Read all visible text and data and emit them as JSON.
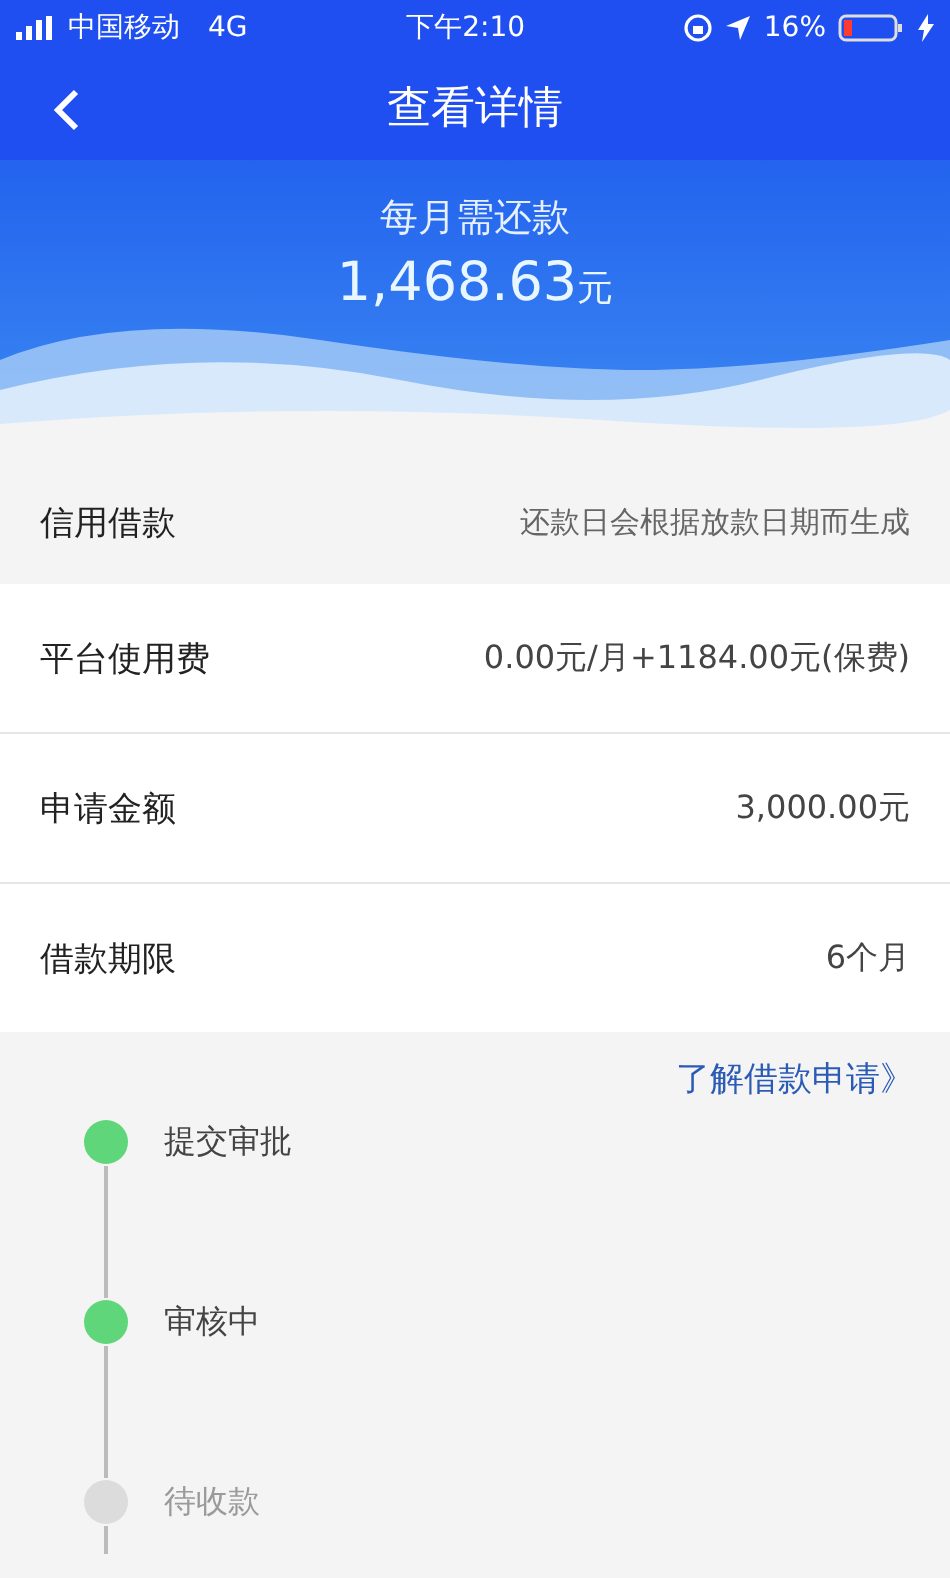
{
  "status_bar": {
    "carrier": "中国移动",
    "network": "4G",
    "time": "下午2:10",
    "battery": "16%"
  },
  "nav": {
    "title": "查看详情"
  },
  "header": {
    "label": "每月需还款",
    "amount": "1,468.63",
    "unit": "元"
  },
  "rows": [
    {
      "label": "信用借款",
      "value": "还款日会根据放款日期而生成",
      "kind": "note"
    },
    {
      "label": "平台使用费",
      "value": "0.00元/月+1184.00元(保费)",
      "kind": "item"
    },
    {
      "label": "申请金额",
      "value": "3,000.00元",
      "kind": "item"
    },
    {
      "label": "借款期限",
      "value": "6个月",
      "kind": "item"
    }
  ],
  "link": {
    "text": "了解借款申请",
    "arrow": "》"
  },
  "steps": [
    {
      "label": "提交审批",
      "completed": true
    },
    {
      "label": "审核中",
      "completed": true
    },
    {
      "label": "待收款",
      "completed": false
    }
  ]
}
